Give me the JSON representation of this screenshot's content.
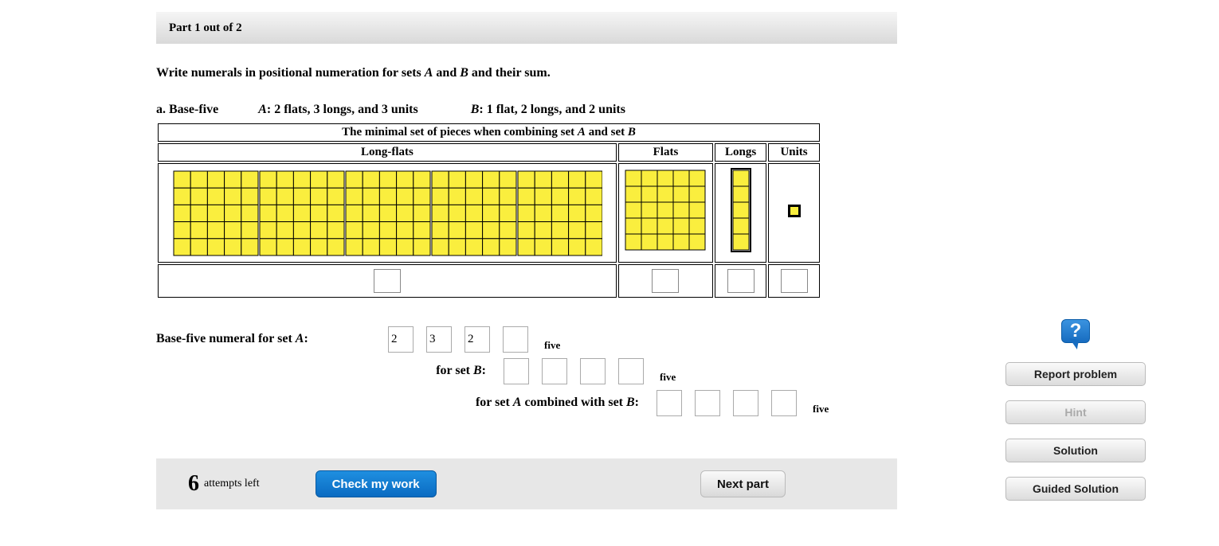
{
  "part_header": "Part 1 out of 2",
  "instruction_pre": "Write numerals in positional numeration for sets ",
  "instruction_A": "A",
  "instruction_mid": " and ",
  "instruction_B": "B",
  "instruction_post": " and their sum.",
  "line_a": {
    "prefix": "a. Base-five",
    "A_label": "A",
    "A_desc": ": 2 flats, 3 longs, and 3 units",
    "B_label": "B",
    "B_desc": ": 1 flat, 2 longs, and 2 units"
  },
  "table": {
    "title_pre": "The minimal set of pieces when combining set ",
    "title_A": "A",
    "title_mid": " and set ",
    "title_B": "B",
    "col_longflats": "Long-flats",
    "col_flats": "Flats",
    "col_longs": "Longs",
    "col_units": "Units"
  },
  "answers": {
    "rowA_label_pre": "Base-five numeral for set ",
    "rowA_label_A": "A",
    "rowA_label_post": ": ",
    "A_digits": [
      "2",
      "3",
      "2",
      ""
    ],
    "rowB_label_pre": "for set ",
    "rowB_label_B": "B",
    "rowB_label_post": ": ",
    "B_digits": [
      "",
      "",
      "",
      ""
    ],
    "rowC_label_pre": "for set ",
    "rowC_label_A": "A",
    "rowC_label_mid": " combined with set ",
    "rowC_label_B": "B",
    "rowC_label_post": ": ",
    "C_digits": [
      "",
      "",
      "",
      ""
    ],
    "subscript": "five"
  },
  "footer": {
    "attempts_num": "6",
    "attempts_text": "attempts left",
    "check_label": "Check my work",
    "next_label": "Next part"
  },
  "sidebar": {
    "help_glyph": "?",
    "report": "Report problem",
    "hint": "Hint",
    "solution": "Solution",
    "guided": "Guided Solution"
  }
}
